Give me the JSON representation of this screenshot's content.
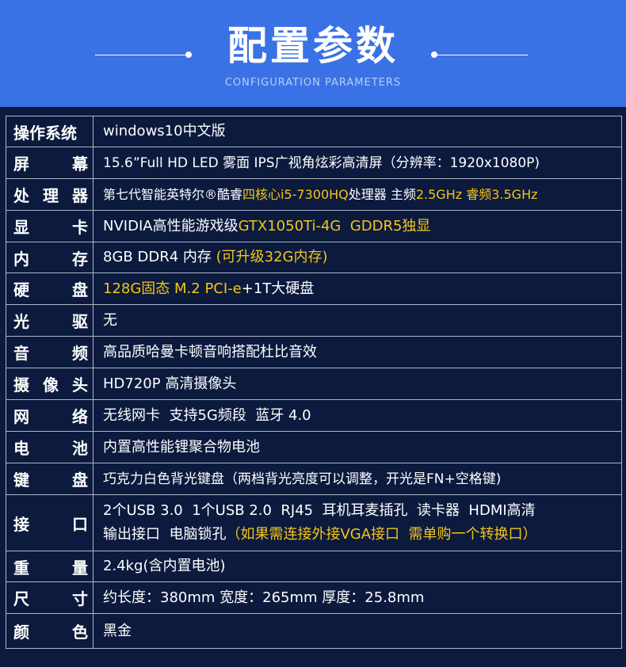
{
  "header": {
    "title": "配置参数",
    "subtitle": "CONFIGURATION PARAMETERS"
  },
  "specs": [
    {
      "label": [
        "操",
        "作",
        "系",
        "统"
      ],
      "value": [
        "windows10中文版"
      ]
    },
    {
      "label": [
        "屏",
        "幕"
      ],
      "value": [
        "15.6”Full HD LED 雾面 IPS广视角炫彩高清屏（分辨率：1920x1080P)"
      ]
    },
    {
      "label": [
        "处",
        "理",
        "器"
      ],
      "value_pre": "第七代智能英特尔®酷睿",
      "value_hl": "四核心i5-7300HQ",
      "value_mid": "处理器 主频",
      "value_hl2": "2.5GHz 睿频3.5GHz"
    },
    {
      "label": [
        "显",
        "卡"
      ],
      "value_pre": "NVIDIA高性能游戏级",
      "value_hl": "GTX1050Ti-4G  GDDR5独显"
    },
    {
      "label": [
        "内",
        "存"
      ],
      "value_pre": "8GB DDR4 内存 ",
      "value_hl": "(可升级32G内存)"
    },
    {
      "label": [
        "硬",
        "盘"
      ],
      "value_hl": "128G固态 M.2 PCI-e",
      "value_post": "+1T大硬盘"
    },
    {
      "label": [
        "光",
        "驱"
      ],
      "value": [
        "无"
      ]
    },
    {
      "label": [
        "音",
        "频"
      ],
      "value": [
        "高品质哈曼卡顿音响搭配杜比音效"
      ]
    },
    {
      "label": [
        "摄",
        "像",
        "头"
      ],
      "value": [
        "HD720P 高清摄像头"
      ]
    },
    {
      "label": [
        "网",
        "络"
      ],
      "value": [
        "无线网卡  支持5G频段  蓝牙 4.0"
      ]
    },
    {
      "label": [
        "电",
        "池"
      ],
      "value": [
        "内置高性能锂聚合物电池"
      ]
    },
    {
      "label": [
        "键",
        "盘"
      ],
      "value": [
        "巧克力白色背光键盘（两档背光亮度可以调整，开光是FN+空格键)"
      ]
    },
    {
      "label": [
        "接",
        "口"
      ],
      "value_line1": "2个USB 3.0  1个USB 2.0  RJ45  耳机耳麦插孔  读卡器  HDMI高清",
      "value_line2_pre": "输出接口  电脑锁孔",
      "value_line2_hl": "（如果需连接外接VGA接口  需单购一个转换口）"
    },
    {
      "label": [
        "重",
        "量"
      ],
      "value": [
        "2.4kg(含内置电池)"
      ]
    },
    {
      "label": [
        "尺",
        "寸"
      ],
      "value": [
        "约长度：380mm 宽度：265mm 厚度：25.8mm"
      ]
    },
    {
      "label": [
        "颜",
        "色"
      ],
      "value": [
        "黑金"
      ]
    }
  ],
  "colors": {
    "header_bg": "#3a72e6",
    "page_bg": "#0b1a3d",
    "highlight": "#f5c518",
    "border": "#aeb6c8"
  }
}
